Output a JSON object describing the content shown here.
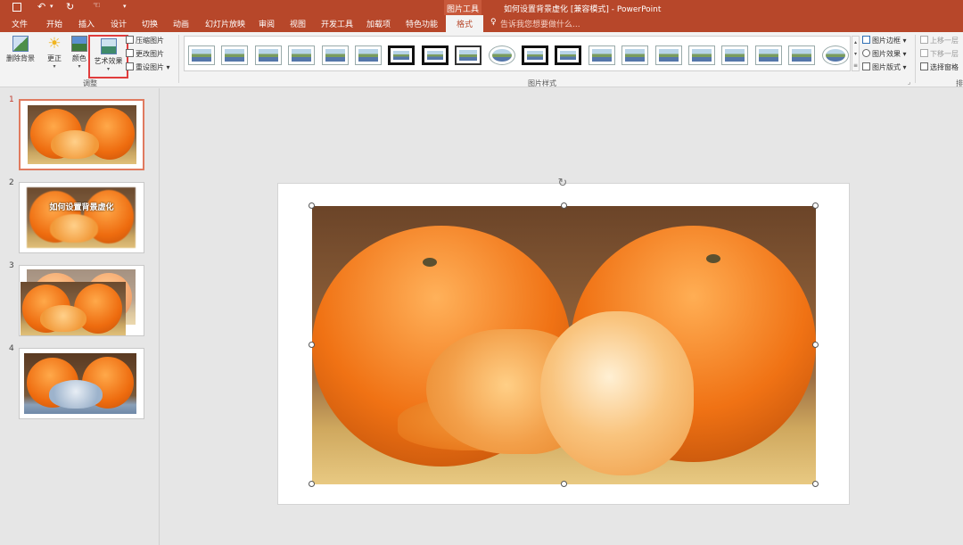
{
  "titlebar": {
    "context_tab": "图片工具",
    "title": "如何设置背景虚化 [兼容模式] - PowerPoint",
    "qat": {
      "save_icon": "save-icon",
      "undo_icon": "undo-icon",
      "redo_icon": "redo-icon",
      "touch_icon": "touch-mode-icon",
      "customize_icon": "customize-icon"
    }
  },
  "tabs": [
    {
      "label": "文件"
    },
    {
      "label": "开始"
    },
    {
      "label": "插入"
    },
    {
      "label": "设计"
    },
    {
      "label": "切换"
    },
    {
      "label": "动画"
    },
    {
      "label": "幻灯片放映"
    },
    {
      "label": "审阅"
    },
    {
      "label": "视图"
    },
    {
      "label": "开发工具"
    },
    {
      "label": "加载项"
    },
    {
      "label": "特色功能"
    },
    {
      "label": "格式",
      "active": true
    }
  ],
  "tellme": "告诉我您想要做什么...",
  "ribbon": {
    "adjust": {
      "remove_bg": "删除背景",
      "corrections": "更正",
      "color": "颜色",
      "artistic": "艺术效果",
      "compress": "压缩图片",
      "change": "更改图片",
      "reset": "重设图片",
      "group_label": "调整"
    },
    "styles": {
      "group_label": "图片样式",
      "count": 20
    },
    "style_side": {
      "border": "图片边框",
      "effects": "图片效果",
      "layout": "图片版式"
    },
    "arrange": {
      "forward": "上移一层",
      "backward": "下移一层",
      "selection": "选择窗格",
      "group_label": "排"
    }
  },
  "slides": [
    {
      "num": "1",
      "selected": true,
      "caption": ""
    },
    {
      "num": "2",
      "selected": false,
      "caption": "如何设置背景虚化"
    },
    {
      "num": "3",
      "selected": false,
      "caption": ""
    },
    {
      "num": "4",
      "selected": false,
      "caption": ""
    }
  ],
  "colors": {
    "accent": "#b7472a",
    "highlight": "#e03c3c"
  }
}
